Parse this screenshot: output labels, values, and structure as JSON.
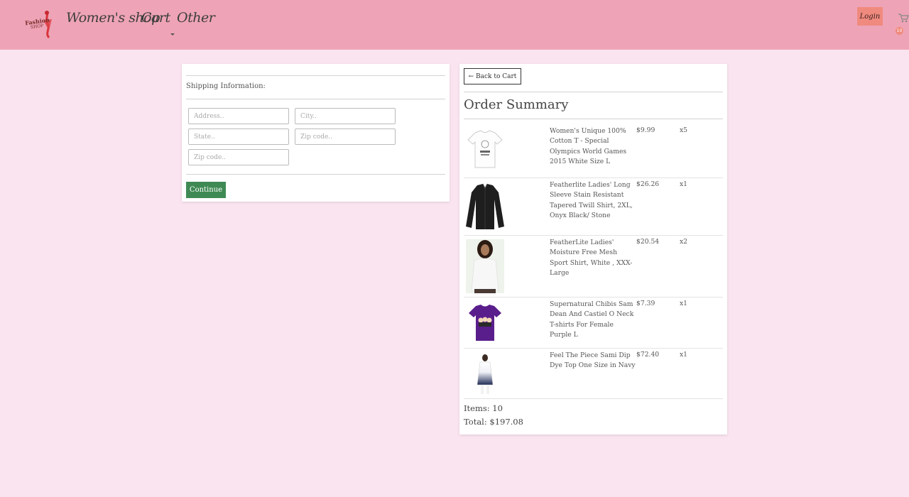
{
  "header": {
    "logo_text_line1": "Fashion",
    "logo_text_line2": "SHOP",
    "nav": {
      "womens_shop": "Women's shop",
      "cart": "Cart",
      "other": "Other"
    },
    "login_label": "Login",
    "cart_count": "10",
    "background_color": "#eea4b6",
    "accent_color": "#f08a7e"
  },
  "shipping": {
    "title": "Shipping Information:",
    "fields": {
      "address_placeholder": "Address..",
      "city_placeholder": "City..",
      "state_placeholder": "State..",
      "zip_placeholder": "Zip code..",
      "zip2_placeholder": "Zip code.."
    },
    "continue_label": "Continue",
    "continue_color": "#3f8a54"
  },
  "summary": {
    "back_label": "← Back to Cart",
    "title": "Order Summary",
    "items": [
      {
        "name": "Women's Unique 100% Cotton T - Special Olympics World Games 2015 White Size L",
        "price": "$9.99",
        "qty": "x5",
        "icon": "white-tshirt-icon"
      },
      {
        "name": "Featherlite Ladies' Long Sleeve Stain Resistant Tapered Twill Shirt, 2XL, Onyx Black/ Stone",
        "price": "$26.26",
        "qty": "x1",
        "icon": "black-shirt-icon"
      },
      {
        "name": "FeatherLite Ladies' Moisture Free Mesh Sport Shirt, White , XXX-Large",
        "price": "$20.54",
        "qty": "x2",
        "icon": "model-white-shirt-icon"
      },
      {
        "name": "Supernatural Chibis Sam Dean And Castiel O Neck T-shirts For Female Purple L",
        "price": "$7.39",
        "qty": "x1",
        "icon": "purple-tshirt-icon"
      },
      {
        "name": "Feel The Piece Sami Dip Dye Top One Size in Navy",
        "price": "$72.40",
        "qty": "x1",
        "icon": "dip-dye-top-icon"
      }
    ],
    "items_count_text": "Items: 10",
    "total_text": "Total: $197.08"
  }
}
